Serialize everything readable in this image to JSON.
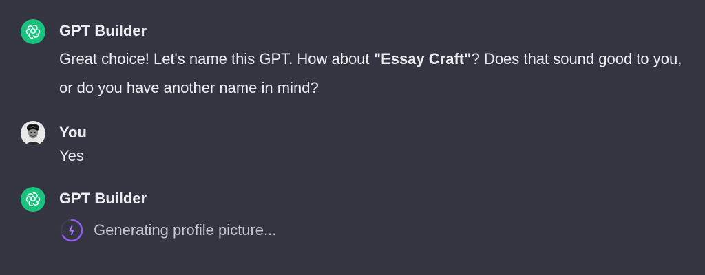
{
  "messages": [
    {
      "author": "GPT Builder",
      "avatar_icon": "openai-logo-icon",
      "text_before": "Great choice! Let's name this GPT. How about ",
      "text_bold": "\"Essay Craft\"",
      "text_after": "? Does that sound good to you, or do you have another name in mind?"
    },
    {
      "author": "You",
      "avatar_icon": "user-avatar",
      "text": "Yes"
    },
    {
      "author": "GPT Builder",
      "avatar_icon": "openai-logo-icon",
      "status_text": "Generating profile picture...",
      "status_icon": "loading-spinner-icon"
    }
  ],
  "colors": {
    "background": "#343541",
    "gpt_avatar": "#19c37d",
    "spinner": "#8e5cf0"
  }
}
